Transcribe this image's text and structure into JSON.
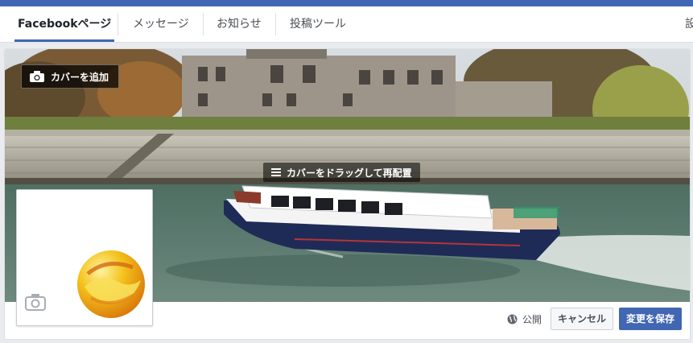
{
  "tabs": [
    {
      "label": "Facebookページ",
      "active": true
    },
    {
      "label": "メッセージ",
      "active": false
    },
    {
      "label": "お知らせ",
      "active": false
    },
    {
      "label": "投稿ツール",
      "active": false
    },
    {
      "label": "設",
      "active": false
    }
  ],
  "cover": {
    "add_cover_label": "カバーを追加",
    "drag_hint": "カバーをドラッグして再配置",
    "icons": {
      "add_cover": "camera-icon",
      "drag": "hamburger-icon"
    }
  },
  "profile": {
    "icons": {
      "camera": "camera-icon",
      "logo": "page-logo"
    }
  },
  "actions": {
    "privacy_label": "公開",
    "privacy_icon": "globe-icon",
    "cancel_label": "キャンセル",
    "save_label": "変更を保存"
  },
  "colors": {
    "brand": "#4267b2",
    "background": "#e9ebee",
    "border": "#dddfe2"
  }
}
